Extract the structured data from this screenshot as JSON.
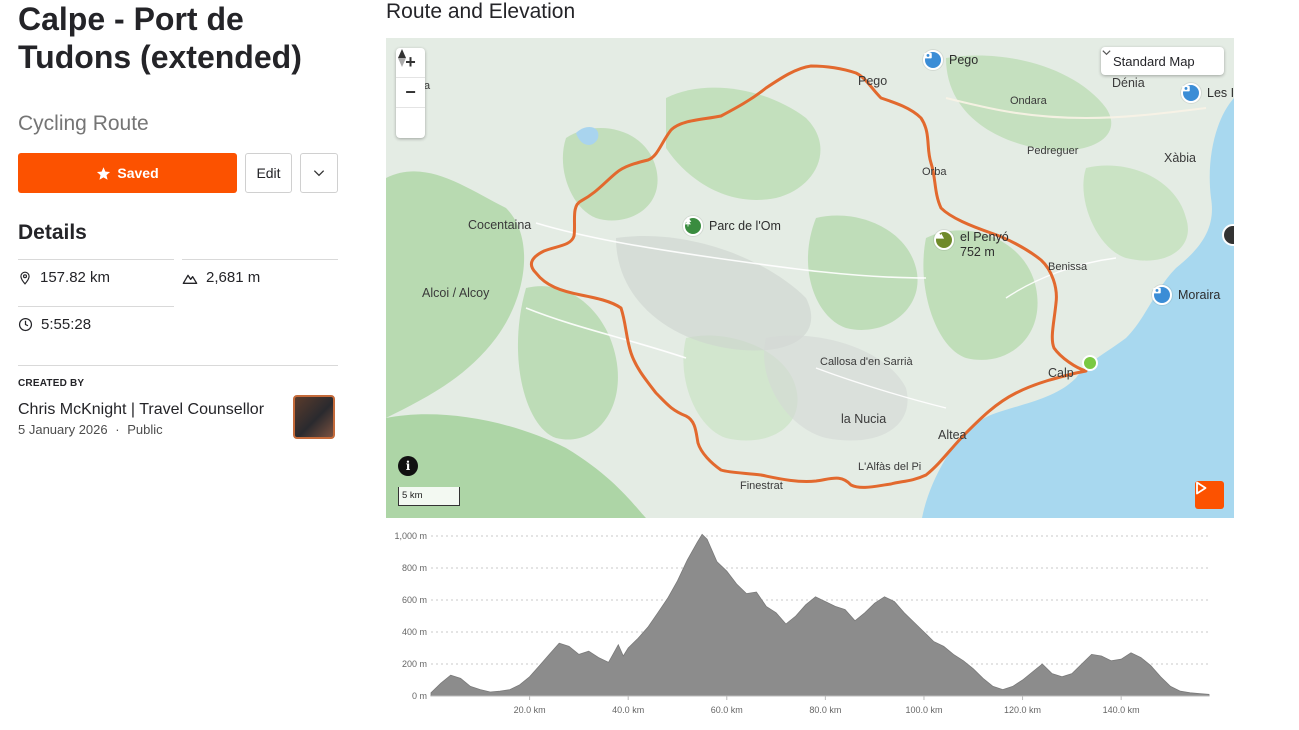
{
  "route": {
    "title": "Calpe - Port de Tudons (extended)",
    "type": "Cycling Route"
  },
  "actions": {
    "saved_label": "Saved",
    "edit_label": "Edit"
  },
  "details": {
    "heading": "Details",
    "distance": "157.82 km",
    "elevation_gain": "2,681 m",
    "time": "5:55:28"
  },
  "creator": {
    "label": "CREATED BY",
    "name": "Chris McKnight | Travel Counsellor",
    "date": "5 January 2026",
    "separator": "·",
    "visibility": "Public"
  },
  "map": {
    "section_title": "Route and Elevation",
    "map_style": "Standard Map",
    "scale_label": "5 km",
    "route_color": "#e2692e",
    "start_color": "#7ac943",
    "places": {
      "pego": "Pego",
      "pego_poi": "Pego",
      "denia": "Dénia",
      "les": "Les I",
      "ondara": "Ondara",
      "pedreguer": "Pedreguer",
      "xabia": "Xàbia",
      "orba": "Orba",
      "cocentaina": "Cocentaina",
      "parc": "Parc de l'Om",
      "penyo": "el Penyó",
      "penyo_alt": "752 m",
      "benissa": "Benissa",
      "moraira": "Moraira",
      "alcoi": "Alcoi / Alcoy",
      "callosa": "Callosa d'en Sarrià",
      "calp": "Calp",
      "la_nucia": "la Nucia",
      "altea": "Altea",
      "alfas": "L'Alfàs del Pi",
      "finestrat": "Finestrat",
      "a_partial": "A",
      "a2_partial": "a"
    }
  },
  "chart_data": {
    "type": "area",
    "xlabel": "",
    "ylabel": "",
    "x_unit": "km",
    "y_unit": "m",
    "xlim": [
      0,
      157.82
    ],
    "ylim": [
      0,
      1000
    ],
    "x_ticks": [
      "20.0 km",
      "40.0 km",
      "60.0 km",
      "80.0 km",
      "100.0 km",
      "120.0 km",
      "140.0 km"
    ],
    "y_ticks": [
      "0 m",
      "200 m",
      "400 m",
      "600 m",
      "800 m",
      "1,000 m"
    ],
    "grid": true,
    "fill_color": "#8c8c8c",
    "series": [
      {
        "x": [
          0,
          2,
          4,
          6,
          8,
          10,
          12,
          14,
          16,
          18,
          20,
          22,
          24,
          26,
          28,
          30,
          32,
          34,
          36,
          38,
          39,
          40,
          42,
          44,
          46,
          48,
          50,
          52,
          54,
          55,
          56,
          58,
          60,
          62,
          64,
          66,
          68,
          70,
          72,
          74,
          76,
          78,
          80,
          82,
          84,
          86,
          88,
          90,
          92,
          94,
          96,
          98,
          100,
          102,
          104,
          106,
          108,
          110,
          112,
          114,
          116,
          118,
          120,
          122,
          124,
          126,
          128,
          130,
          132,
          134,
          136,
          138,
          140,
          142,
          144,
          146,
          148,
          150,
          152,
          154,
          156,
          157.82
        ],
        "y": [
          20,
          80,
          130,
          110,
          60,
          40,
          25,
          30,
          40,
          70,
          120,
          190,
          260,
          330,
          310,
          260,
          280,
          240,
          210,
          320,
          250,
          300,
          360,
          430,
          520,
          610,
          720,
          850,
          960,
          1010,
          980,
          840,
          780,
          700,
          640,
          650,
          560,
          520,
          450,
          500,
          570,
          620,
          590,
          560,
          540,
          470,
          520,
          580,
          620,
          590,
          520,
          460,
          400,
          340,
          310,
          260,
          220,
          170,
          110,
          60,
          40,
          60,
          100,
          150,
          200,
          140,
          120,
          140,
          200,
          260,
          250,
          220,
          230,
          270,
          240,
          190,
          120,
          60,
          30,
          20,
          15,
          10
        ]
      }
    ]
  }
}
